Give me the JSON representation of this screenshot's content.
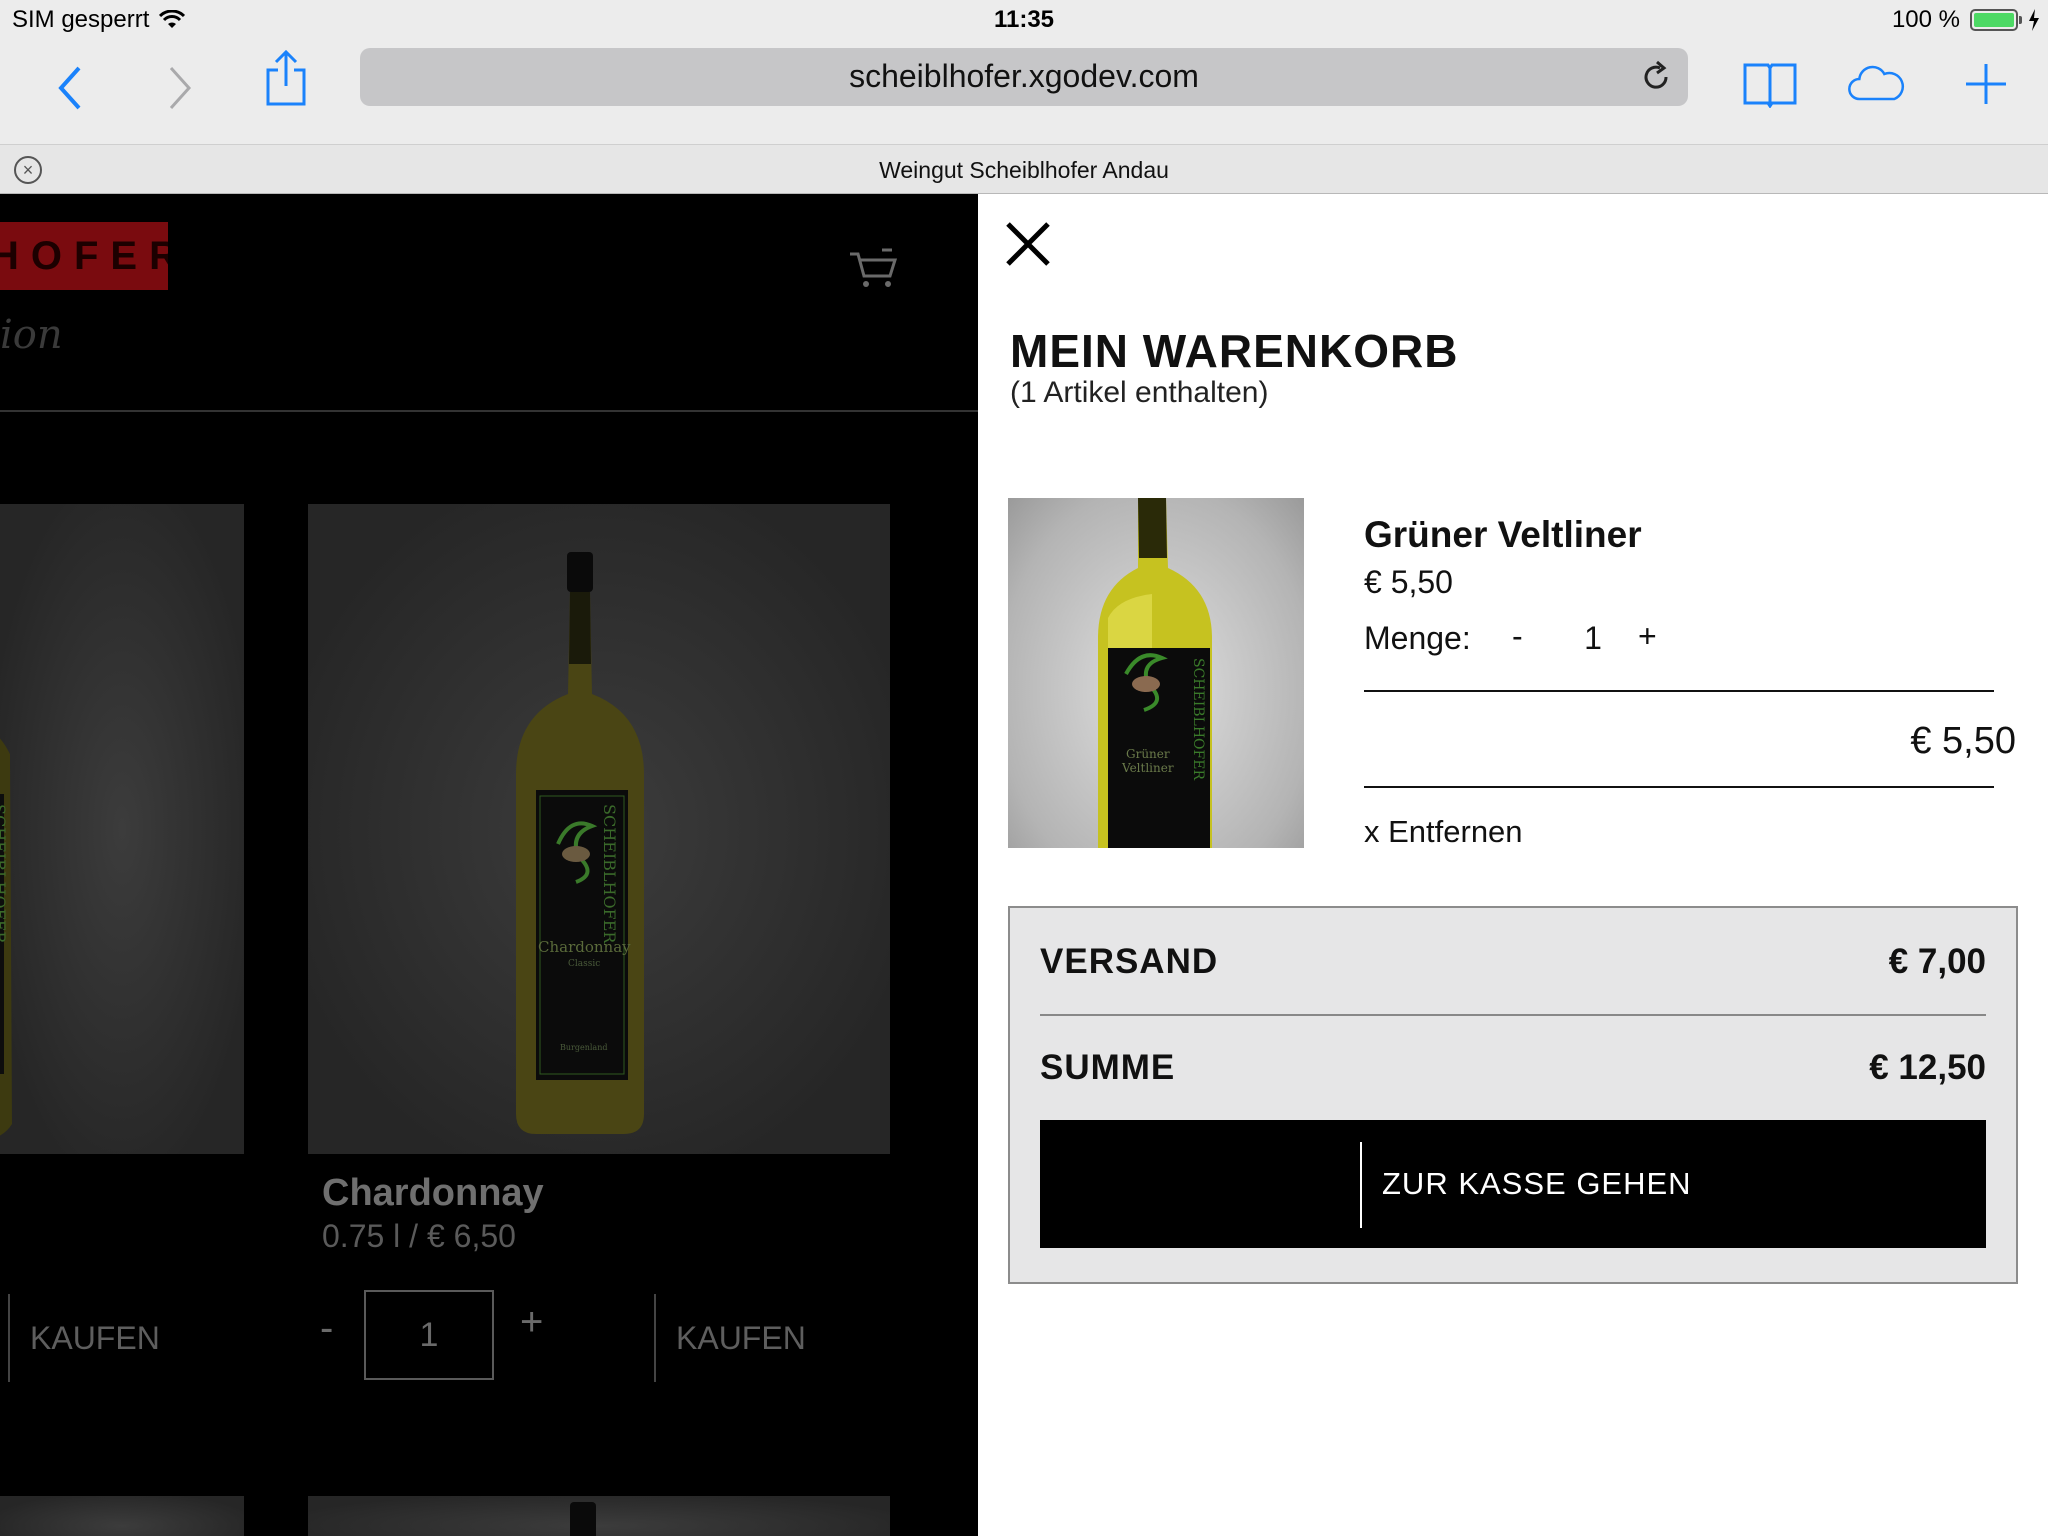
{
  "status": {
    "carrier": "SIM gesperrt",
    "time": "11:35",
    "battery": "100 %"
  },
  "browser": {
    "url": "scheiblhofer.xgodev.com",
    "tab_title": "Weingut Scheiblhofer Andau"
  },
  "page": {
    "logo_text": "HOFER",
    "script_text": "ion",
    "product": {
      "name": "Chardonnay",
      "meta": "0.75 l  /  € 6,50",
      "label_name": "Chardonnay",
      "label_sub": "Classic",
      "label_region": "Burgenland",
      "label_brand": "SCHEIBLHOFER",
      "qty": "1",
      "minus": "-",
      "plus": "+",
      "buy": "KAUFEN"
    },
    "left_product": {
      "buy": "KAUFEN"
    }
  },
  "cart": {
    "title": "MEIN WARENKORB",
    "count": "(1 Artikel enthalten)",
    "item": {
      "name": "Grüner Veltliner",
      "price": "€ 5,50",
      "menge_label": "Menge:",
      "minus": "-",
      "qty": "1",
      "plus": "+",
      "total": "€ 5,50",
      "remove": "x Entfernen",
      "label_text1": "Grüner",
      "label_text2": "Veltliner",
      "label_brand": "SCHEIBLHOFER"
    },
    "shipping_label": "VERSAND",
    "shipping_value": "€ 7,00",
    "sum_label": "SUMME",
    "sum_value": "€ 12,50",
    "checkout_label": "ZUR KASSE GEHEN"
  },
  "colors": {
    "accent_blue": "#1a82fb",
    "logo_red": "#7a0b0f",
    "battery_green": "#4cd964"
  }
}
